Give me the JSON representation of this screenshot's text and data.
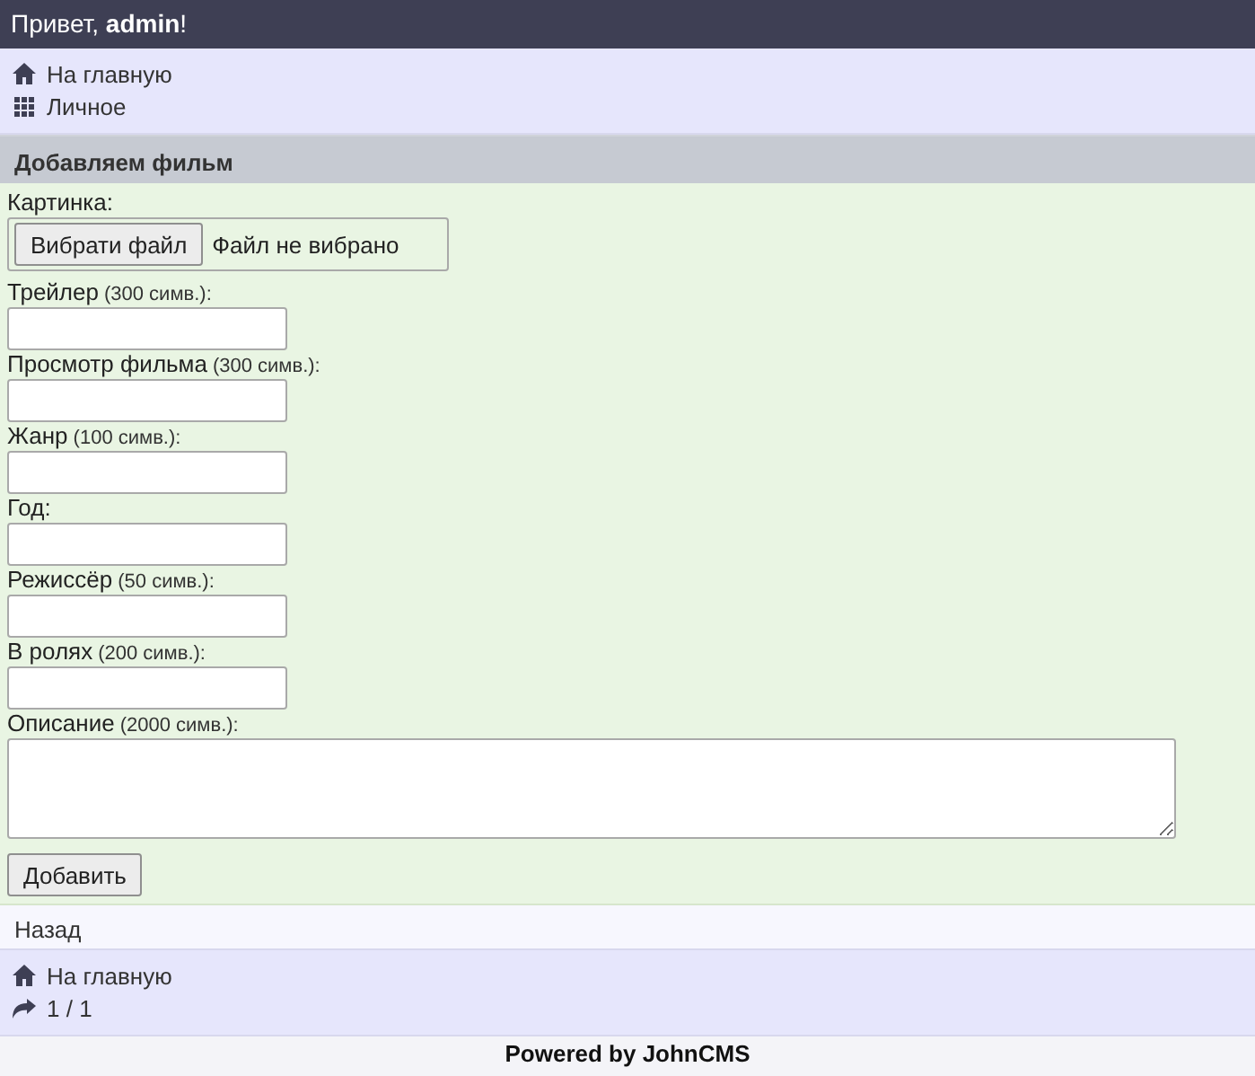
{
  "header": {
    "greeting": "Привет, **admin**!"
  },
  "top_nav": [
    {
      "kind": "home",
      "label": "На главную"
    },
    {
      "kind": "grid",
      "label": "Личное"
    }
  ],
  "form": {
    "title": "Добавляем фильм",
    "fields": [
      {
        "kind": "file",
        "label": "Картинка:",
        "button": "Вибрати файл",
        "status": "Файл не вибрано"
      },
      {
        "kind": "text",
        "label": "Трейлер",
        "hint": "(300 симв.):"
      },
      {
        "kind": "text",
        "label": "Просмотр фильма",
        "hint": "(300 симв.):"
      },
      {
        "kind": "text",
        "label": "Жанр",
        "hint": "(100 симв.):"
      },
      {
        "kind": "text",
        "label": "Год:"
      },
      {
        "kind": "text",
        "label": "Режиссёр",
        "hint": "(50 симв.):"
      },
      {
        "kind": "text",
        "label": "В ролях",
        "hint": "(200 симв.):"
      },
      {
        "kind": "textarea",
        "label": "Описание",
        "hint": "(2000 симв.):"
      }
    ],
    "submit": "Добавить"
  },
  "back_link": "Назад",
  "bottom_nav": [
    {
      "kind": "home",
      "label": "На главную"
    },
    {
      "kind": "arrow",
      "label": "1 / 1"
    }
  ],
  "footer": "Powered by JohnCMS"
}
